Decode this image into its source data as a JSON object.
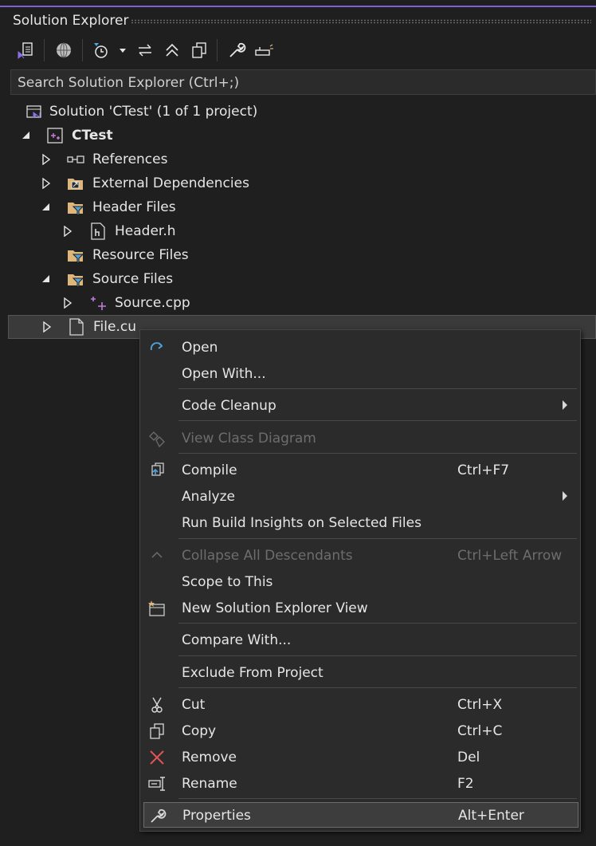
{
  "panel": {
    "title": "Solution Explorer"
  },
  "toolbar": {
    "buttons": [
      {
        "icon": "vs-switch-views-icon"
      },
      {
        "icon": "globe-icon"
      },
      {
        "icon": "pending-changes-filter-icon"
      },
      {
        "icon": "sync-with-active-document-icon"
      },
      {
        "icon": "collapse-all-icon"
      },
      {
        "icon": "show-all-files-icon"
      },
      {
        "icon": "properties-wrench-icon"
      },
      {
        "icon": "preview-selected-items-icon"
      }
    ]
  },
  "search": {
    "placeholder": "Search Solution Explorer (Ctrl+;)"
  },
  "tree": {
    "solution": "Solution 'CTest'  (1 of 1 project)",
    "project": "CTest",
    "references": "References",
    "external": "External Dependencies",
    "header_files": "Header Files",
    "header_h": "Header.h",
    "resource_files": "Resource Files",
    "source_files": "Source Files",
    "source_cpp": "Source.cpp",
    "file_cu": "File.cu"
  },
  "menu": {
    "open": {
      "label": "Open"
    },
    "open_with": {
      "label": "Open With..."
    },
    "code_cleanup": {
      "label": "Code Cleanup"
    },
    "view_class_diagram": {
      "label": "View Class Diagram"
    },
    "compile": {
      "label": "Compile",
      "shortcut": "Ctrl+F7"
    },
    "analyze": {
      "label": "Analyze"
    },
    "run_build_insights": {
      "label": "Run Build Insights on Selected Files"
    },
    "collapse_all": {
      "label": "Collapse All Descendants",
      "shortcut": "Ctrl+Left Arrow"
    },
    "scope_to_this": {
      "label": "Scope to This"
    },
    "new_view": {
      "label": "New Solution Explorer View"
    },
    "compare_with": {
      "label": "Compare With..."
    },
    "exclude": {
      "label": "Exclude From Project"
    },
    "cut": {
      "label": "Cut",
      "shortcut": "Ctrl+X"
    },
    "copy": {
      "label": "Copy",
      "shortcut": "Ctrl+C"
    },
    "remove": {
      "label": "Remove",
      "shortcut": "Del"
    },
    "rename": {
      "label": "Rename",
      "shortcut": "F2"
    },
    "properties": {
      "label": "Properties",
      "shortcut": "Alt+Enter"
    }
  },
  "colors": {
    "accent": "#7b60d8",
    "folder": "#dcb67a",
    "cpp": "#c27bd6",
    "link": "#4fa3e0",
    "remove": "#e05555"
  }
}
